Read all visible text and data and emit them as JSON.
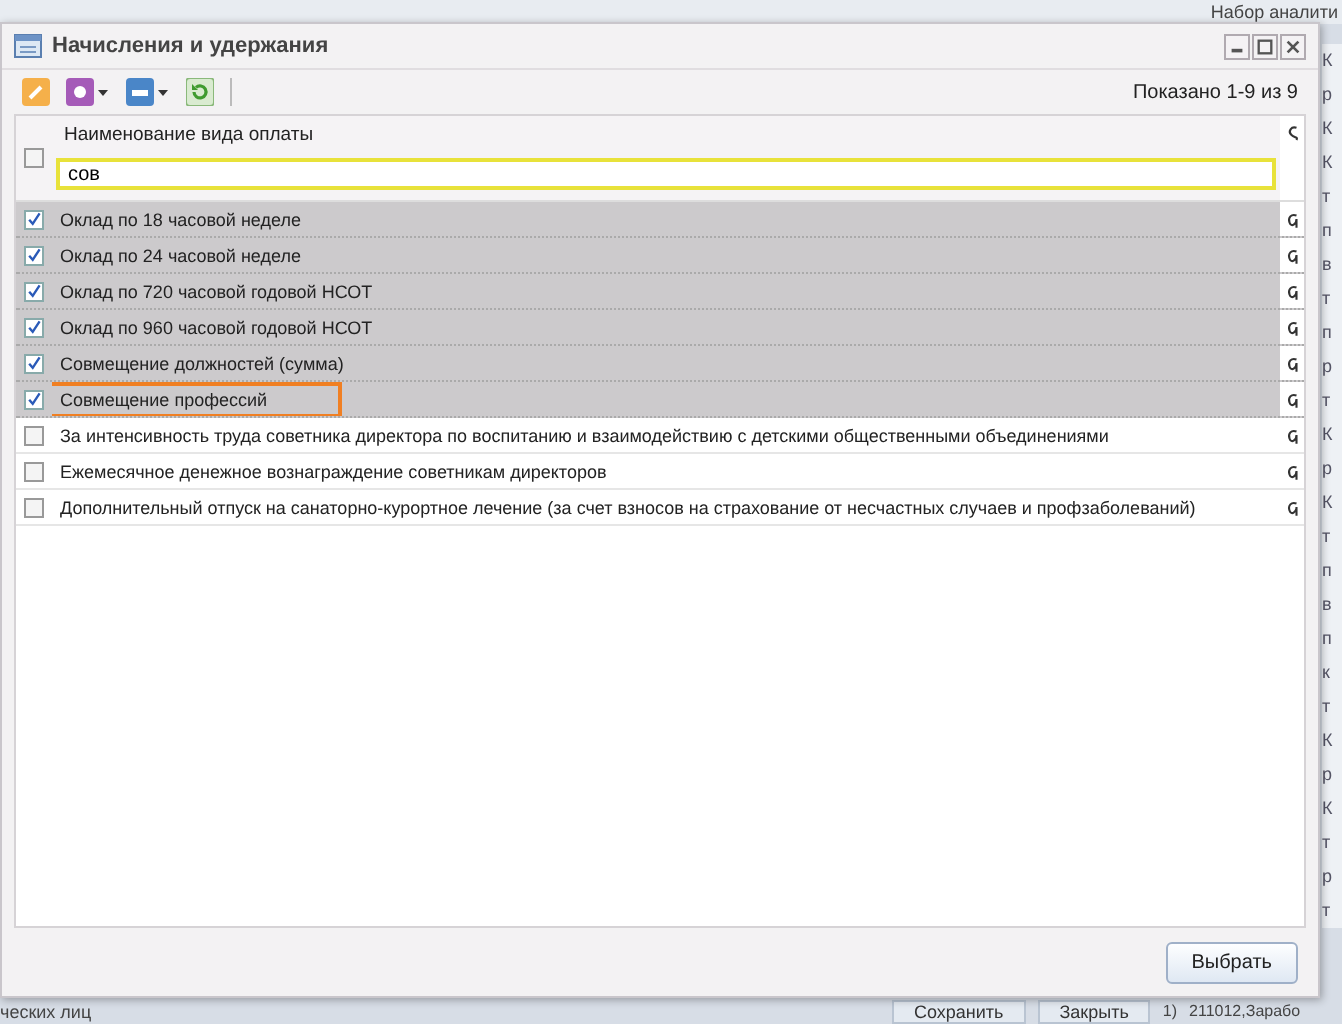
{
  "background": {
    "top_text": "Набор аналити",
    "side_texts": [
      "К",
      "р",
      "К",
      "К",
      "т",
      "п",
      "в",
      "т",
      "п",
      "р",
      "т",
      "К",
      "р",
      "К",
      "т",
      "п",
      "в",
      "п",
      "к",
      "т",
      "К",
      "р",
      "К",
      "т",
      "р",
      "т"
    ],
    "bottom_left": "ческих лиц",
    "bottom_buttons": [
      "Сохранить",
      "Закрыть"
    ],
    "bottom_cells": [
      "1)",
      "211012,Зарабо"
    ]
  },
  "window": {
    "title": "Начисления и удержания",
    "paging": "Показано 1-9 из 9"
  },
  "table": {
    "column": "Наименование вида оплаты",
    "header_checked": false,
    "filter_value": "сов",
    "rows": [
      {
        "name": "Оклад по 18 часовой неделе",
        "checked": true,
        "highlighted": false
      },
      {
        "name": "Оклад по 24 часовой неделе",
        "checked": true,
        "highlighted": false
      },
      {
        "name": "Оклад по 720 часовой годовой НСОТ",
        "checked": true,
        "highlighted": false
      },
      {
        "name": "Оклад по 960 часовой годовой НСОТ",
        "checked": true,
        "highlighted": false
      },
      {
        "name": "Совмещение должностей (сумма)",
        "checked": true,
        "highlighted": false
      },
      {
        "name": "Совмещение профессий",
        "checked": true,
        "highlighted": true
      },
      {
        "name": "За интенсивность труда советника директора по воспитанию и взаимодействию с детскими общественными объединениями",
        "checked": false,
        "highlighted": false
      },
      {
        "name": "Ежемесячное денежное вознаграждение советникам директоров",
        "checked": false,
        "highlighted": false
      },
      {
        "name": "Дополнительный отпуск на санаторно-курортное лечение (за счет взносов на страхование от несчастных случаев и профзаболеваний)",
        "checked": false,
        "highlighted": false
      }
    ]
  },
  "buttons": [
    "Выбрать"
  ]
}
